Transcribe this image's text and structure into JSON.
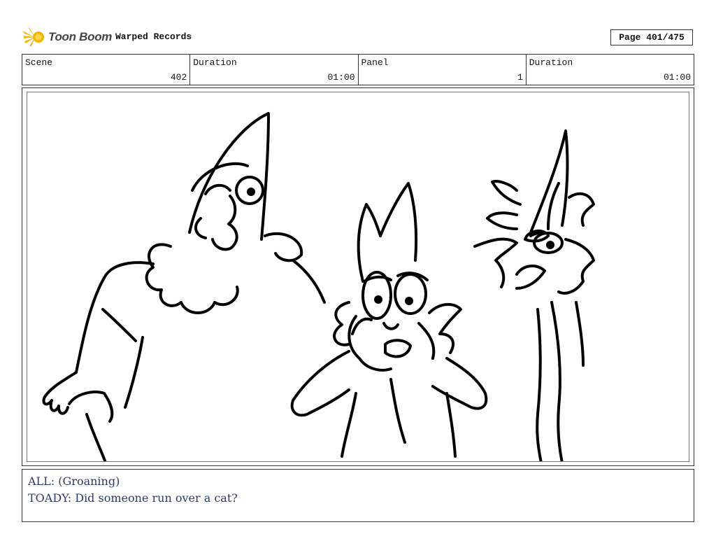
{
  "header": {
    "brand": "Toon Boom",
    "project_title": "Warped Records",
    "page_label": "Page 401/475"
  },
  "info": [
    {
      "label": "Scene",
      "value": "402"
    },
    {
      "label": "Duration",
      "value": "01:00"
    },
    {
      "label": "Panel",
      "value": "1"
    },
    {
      "label": "Duration",
      "value": "01:00"
    }
  ],
  "panel": {
    "image": "storyboard-sketch-three-characters"
  },
  "dialogue": [
    "ALL: (Groaning)",
    "TOADY: Did someone run over a cat?"
  ],
  "colors": {
    "logo_yellow": "#f2b705",
    "dialogue_text": "#2e3a66"
  }
}
